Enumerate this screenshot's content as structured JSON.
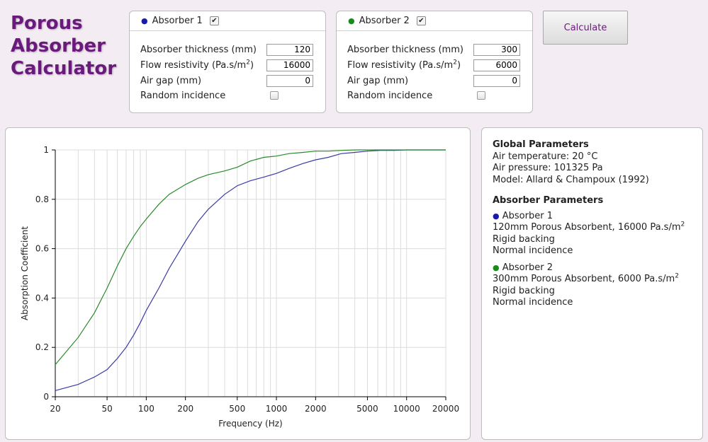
{
  "app": {
    "title": "Porous Absorber Calculator"
  },
  "absorber1": {
    "label": "Absorber 1",
    "enabled": true,
    "color": "#1a1aa8",
    "thickness_label": "Absorber thickness (mm)",
    "thickness": "120",
    "flow_label": "Flow resistivity (Pa.s/m",
    "flow_sup": "2",
    "flow_label_end": ")",
    "flow": "16000",
    "airgap_label": "Air gap (mm)",
    "airgap": "0",
    "random_label": "Random incidence",
    "random": false
  },
  "absorber2": {
    "label": "Absorber 2",
    "enabled": true,
    "color": "#1a8a1a",
    "thickness_label": "Absorber thickness (mm)",
    "thickness": "300",
    "flow_label": "Flow resistivity (Pa.s/m",
    "flow_sup": "2",
    "flow_label_end": ")",
    "flow": "6000",
    "airgap_label": "Air gap (mm)",
    "airgap": "0",
    "random_label": "Random incidence",
    "random": false
  },
  "calculate_label": "Calculate",
  "info": {
    "global_heading": "Global Parameters",
    "air_temperature": "Air temperature: 20 °C",
    "air_pressure": "Air pressure: 101325 Pa",
    "model": "Model: Allard & Champoux (1992)",
    "absorber_heading": "Absorber Parameters",
    "a1": {
      "name": "Absorber 1",
      "desc": "120mm Porous Absorbent, 16000 Pa.s/m",
      "desc_sup": "2",
      "backing": "Rigid backing",
      "incidence": "Normal incidence"
    },
    "a2": {
      "name": "Absorber 2",
      "desc": "300mm Porous Absorbent, 6000 Pa.s/m",
      "desc_sup": "2",
      "backing": "Rigid backing",
      "incidence": "Normal incidence"
    }
  },
  "chart_data": {
    "type": "line",
    "xlabel": "Frequency (Hz)",
    "ylabel": "Absorption Coefficient",
    "xscale": "log",
    "xlim": [
      20,
      20000
    ],
    "ylim": [
      0,
      1
    ],
    "grid": true,
    "xticks": [
      20,
      50,
      100,
      200,
      500,
      1000,
      2000,
      5000,
      10000,
      20000
    ],
    "xtick_labels": [
      "20",
      "50",
      "100",
      "200",
      "500",
      "1000",
      "2000",
      "5000",
      "10000",
      "20000"
    ],
    "yticks": [
      0,
      0.2,
      0.4,
      0.6,
      0.8,
      1
    ],
    "ytick_labels": [
      "0",
      "0.2",
      "0.4",
      "0.6",
      "0.8",
      "1"
    ],
    "series": [
      {
        "color": "#3a3aa8",
        "x": [
          20,
          30,
          40,
          50,
          60,
          70,
          80,
          90,
          100,
          125,
          150,
          200,
          250,
          300,
          400,
          500,
          630,
          800,
          1000,
          1250,
          1600,
          2000,
          2500,
          3150,
          4000,
          5000,
          6300,
          8000,
          10000,
          12500,
          16000,
          20000
        ],
        "y": [
          0.025,
          0.05,
          0.08,
          0.11,
          0.155,
          0.2,
          0.25,
          0.3,
          0.35,
          0.44,
          0.52,
          0.63,
          0.71,
          0.76,
          0.82,
          0.855,
          0.875,
          0.89,
          0.905,
          0.925,
          0.945,
          0.96,
          0.97,
          0.985,
          0.99,
          0.995,
          0.998,
          0.998,
          1.0,
          1.0,
          1.0,
          1.0
        ]
      },
      {
        "color": "#2a8a2a",
        "x": [
          20,
          30,
          40,
          50,
          60,
          70,
          80,
          90,
          100,
          125,
          150,
          200,
          250,
          300,
          400,
          500,
          630,
          800,
          1000,
          1250,
          1600,
          2000,
          2500,
          3150,
          4000,
          5000,
          6300,
          8000,
          10000,
          12500,
          16000,
          20000
        ],
        "y": [
          0.13,
          0.24,
          0.34,
          0.44,
          0.53,
          0.6,
          0.65,
          0.69,
          0.72,
          0.78,
          0.82,
          0.86,
          0.885,
          0.9,
          0.915,
          0.93,
          0.955,
          0.97,
          0.975,
          0.985,
          0.99,
          0.995,
          0.995,
          0.998,
          1.0,
          1.0,
          1.0,
          1.0,
          1.0,
          1.0,
          1.0,
          1.0
        ]
      }
    ]
  }
}
